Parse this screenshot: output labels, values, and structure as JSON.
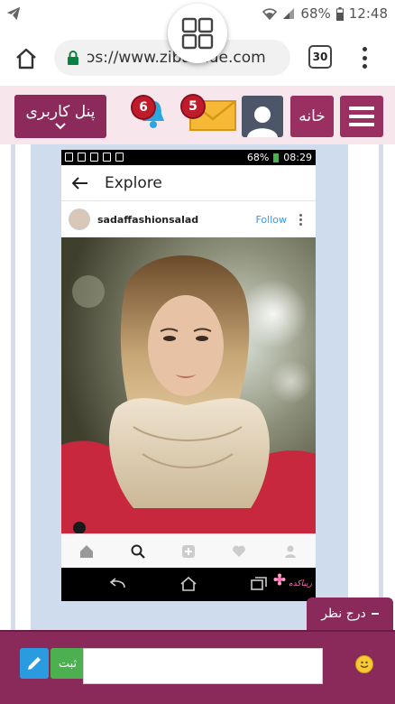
{
  "status_bar": {
    "battery_percent": "68%",
    "time": "12:48"
  },
  "browser": {
    "url": "ɔs://www.zibakade.com",
    "tab_count": "30"
  },
  "site_header": {
    "panel_label": "پنل کاربری",
    "notifications_count": "6",
    "messages_count": "5",
    "home_label": "خانه"
  },
  "embedded_screenshot": {
    "status": {
      "battery": "68%",
      "time": "08:29"
    },
    "page_title": "Explore",
    "username": "sadaffashionsalad",
    "follow_label": "Follow",
    "watermark": "زیباکده"
  },
  "comment": {
    "tab_label": "درج نظر",
    "submit_label": "ثبت",
    "input_value": ""
  },
  "colors": {
    "brand": "#8a2a5a",
    "header_bg": "#f7e6ec",
    "notification_badge": "#c01b2b",
    "submit_green": "#4caf50",
    "pencil_blue": "#2b9be0"
  }
}
